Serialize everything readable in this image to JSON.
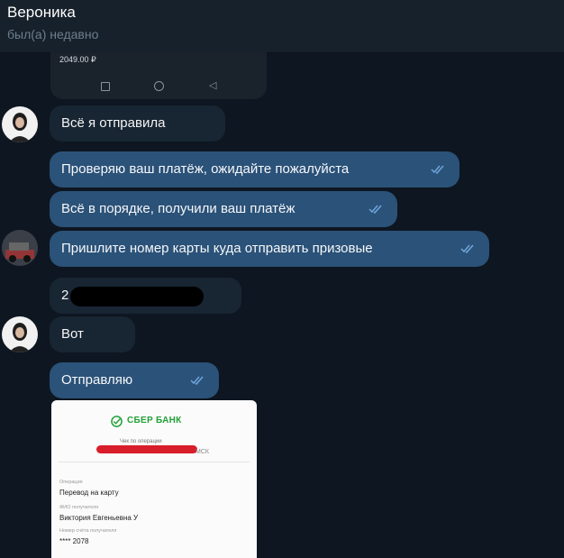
{
  "header": {
    "name": "Вероника",
    "status": "был(а) недавно"
  },
  "attachment": {
    "amount": "2049.00 ₽"
  },
  "messages": [
    {
      "text": "Всё я отправила"
    },
    {
      "text": "Проверяю ваш платёж, ожидайте пожалуйста"
    },
    {
      "text": "Всё в порядке, получили ваш платёж"
    },
    {
      "text": "Пришлите номер карты куда отправить призовые"
    },
    {
      "text": "2"
    },
    {
      "text": "Вот"
    },
    {
      "text": "Отправляю"
    }
  ],
  "receipt": {
    "bank_name": "СБЕР БАНК",
    "subtitle": "Чек по операции",
    "code": "МСК",
    "operation_label": "Операция",
    "operation_value": "Перевод на карту",
    "recipient_label": "ФИО получателя",
    "recipient_value": "Виктория Евгеньевна У",
    "account_label": "Номер счёта получателя",
    "account_value": "**** 2078"
  },
  "colors": {
    "background": "#0e1621",
    "incoming_bubble": "#182533",
    "outgoing_bubble": "#2b5278",
    "sber_green": "#21a038"
  }
}
